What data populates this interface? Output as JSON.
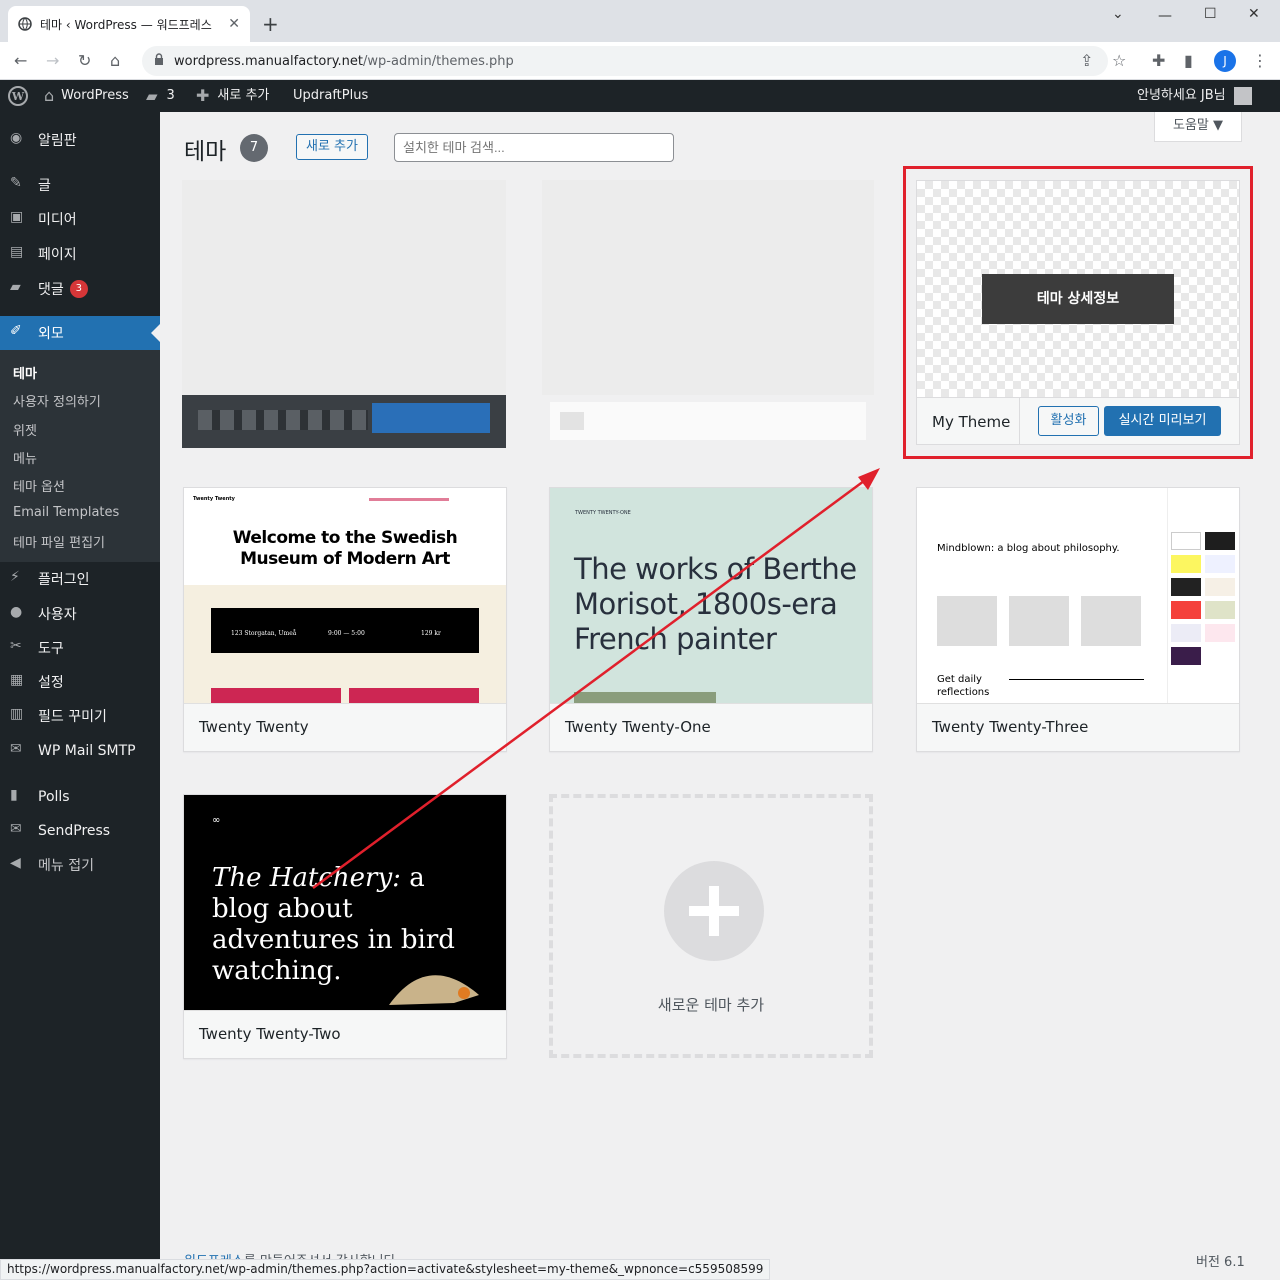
{
  "browser": {
    "tab_title": "테마 ‹ WordPress — 워드프레스",
    "new_tab": "+",
    "url_host": "wordpress.manualfactory.net",
    "url_path": "/wp-admin/themes.php",
    "profile_initial": "J",
    "status_url": "https://wordpress.manualfactory.net/wp-admin/themes.php?action=activate&stylesheet=my-theme&_wpnonce=c559508599"
  },
  "adminbar": {
    "site": "WordPress",
    "comments": "3",
    "new": "새로 추가",
    "updraft": "UpdraftPlus",
    "greeting": "안녕하세요 JB님"
  },
  "sidebar": {
    "items": [
      {
        "label": "알림판"
      },
      {
        "label": "글"
      },
      {
        "label": "미디어"
      },
      {
        "label": "페이지"
      },
      {
        "label": "댓글",
        "badge": "3"
      },
      {
        "label": "외모"
      },
      {
        "label": "플러그인"
      },
      {
        "label": "사용자"
      },
      {
        "label": "도구"
      },
      {
        "label": "설정"
      },
      {
        "label": "필드 꾸미기"
      },
      {
        "label": "WP Mail SMTP"
      },
      {
        "label": "Polls"
      },
      {
        "label": "SendPress"
      },
      {
        "label": "메뉴 접기"
      }
    ],
    "sub_items": [
      "테마",
      "사용자 정의하기",
      "위젯",
      "메뉴",
      "테마 옵션",
      "Email Templates",
      "테마 파일 편집기"
    ]
  },
  "page": {
    "title": "테마",
    "count": "7",
    "add_new": "새로 추가",
    "search_placeholder": "설치한 테마 검색...",
    "help": "도움말 ▼"
  },
  "my_theme": {
    "details": "테마 상세정보",
    "name": "My Theme",
    "activate": "활성화",
    "preview": "실시간 미리보기"
  },
  "themes": [
    {
      "name": "Twenty Twenty",
      "headline": "Welcome to the Swedish Museum of Modern Art",
      "brand": "Twenty Twenty",
      "address": "123 Storgatan, Umeå",
      "hours": "9:00 — 5:00",
      "price": "129 kr"
    },
    {
      "name": "Twenty Twenty-One",
      "headline": "The works of Berthe Morisot, 1800s-era French painter",
      "brand": "TWENTY TWENTY-ONE"
    },
    {
      "name": "Twenty Twenty-Three",
      "headline": "Mindblown: a blog about philosophy.",
      "footer_text": "Get daily reflections"
    },
    {
      "name": "Twenty Twenty-Two",
      "headline_italic": "The Hatchery:",
      "headline_rest": " a blog about adventures in bird watching."
    }
  ],
  "add_theme_label": "새로운 테마 추가",
  "footer": {
    "link": "워드프레스",
    "rest": "를 만들어주셔서 감사합니다.",
    "version": "버전 6.1"
  },
  "colors": {
    "admin_dark": "#1d2327",
    "accent": "#2271b1",
    "highlight_red": "#e0202c"
  }
}
